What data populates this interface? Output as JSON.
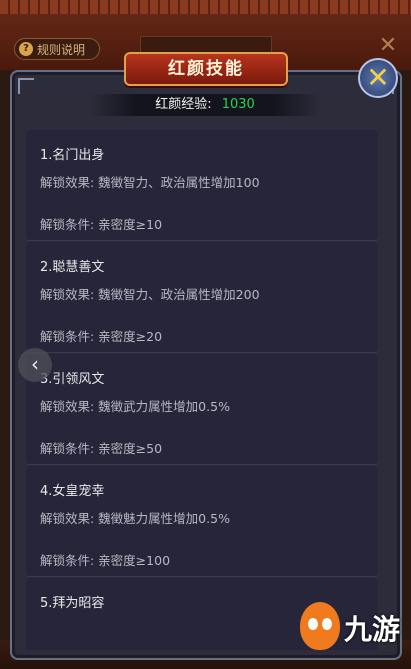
{
  "background": {
    "rules_label": "规则说明",
    "rules_icon": "?",
    "close_glyph": "✕"
  },
  "dialog": {
    "title": "红颜技能",
    "close_glyph": "✕",
    "experience_label": "红颜经验:",
    "experience_value": "1030"
  },
  "skills": [
    {
      "name": "1.名门出身",
      "effect": "解锁效果:  魏徵智力、政治属性增加100",
      "condition": "解锁条件:  亲密度≥10"
    },
    {
      "name": "2.聪慧善文",
      "effect": "解锁效果:  魏徵智力、政治属性增加200",
      "condition": "解锁条件:  亲密度≥20"
    },
    {
      "name": "3.引领风文",
      "effect": "解锁效果:  魏徵武力属性增加0.5%",
      "condition": "解锁条件:  亲密度≥50"
    },
    {
      "name": "4.女皇宠幸",
      "effect": "解锁效果:  魏徵魅力属性增加0.5%",
      "condition": "解锁条件:  亲密度≥100"
    },
    {
      "name": "5.拜为昭容",
      "effect": "",
      "condition": ""
    }
  ],
  "nav": {
    "scroll_left_glyph": "‹"
  },
  "watermark": {
    "text": "九游"
  },
  "colors": {
    "panel": "#2d2c3a",
    "exp_value": "#2fd24a",
    "title_banner": "#b8341c",
    "close_button": "#3c5690"
  }
}
